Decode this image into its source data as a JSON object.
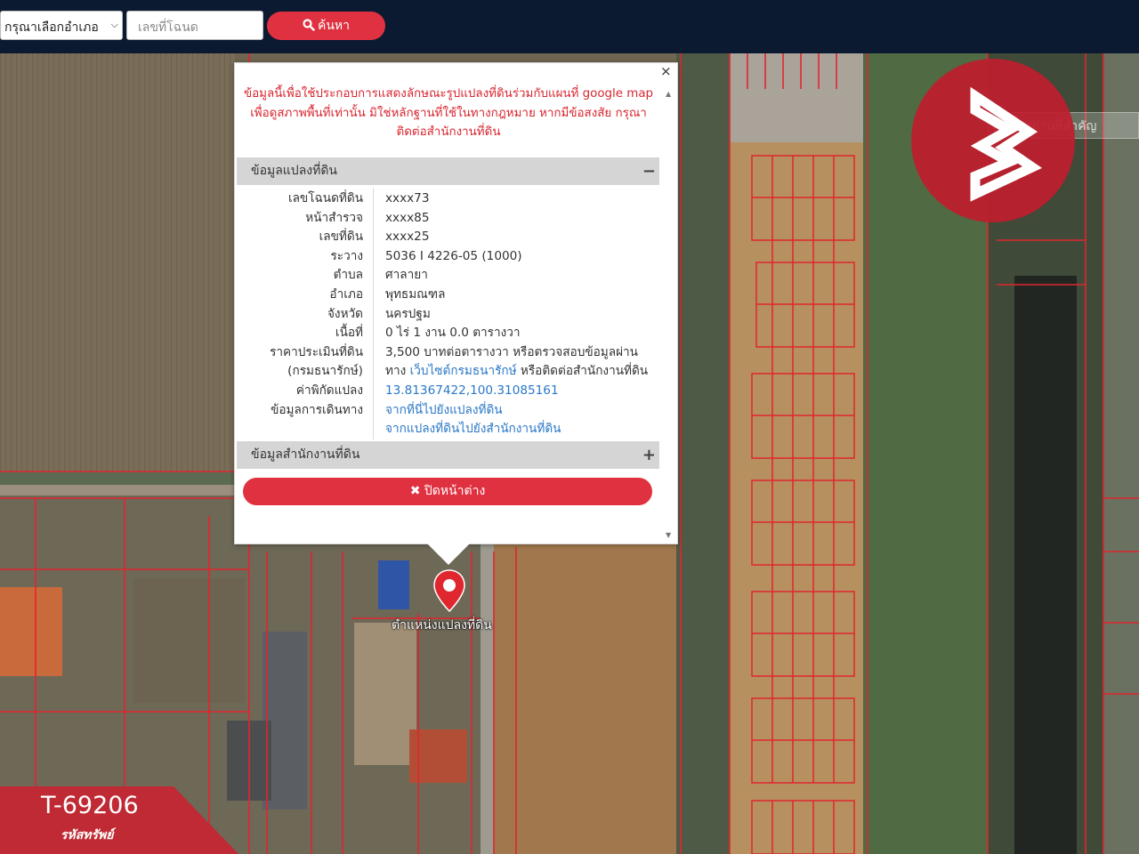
{
  "search": {
    "district_select": "กรุณาเลือกอำเภอ",
    "deed_placeholder": "เลขที่โฉนด",
    "button_label": "ค้นหา"
  },
  "map": {
    "place_search_placeholder": "ค้นหาสถานที่สำคัญ",
    "marker_label": "ตำแหน่งแปลงที่ดิน"
  },
  "popup": {
    "close_symbol": "×",
    "notice": [
      "ข้อมูลนี้เพื่อใช้ประกอบการแสดงลักษณะรูปแปลงที่ดินร่วมกับแผนที่ google map",
      "เพื่อดูสภาพพื้นที่เท่านั้น มิใช่หลักฐานที่ใช้ในทางกฎหมาย หากมีข้อสงสัย กรุณา",
      "ติดต่อสำนักงานที่ดิน"
    ],
    "section_parcel": {
      "title": "ข้อมูลแปลงที่ดิน",
      "toggle": "−"
    },
    "section_office": {
      "title": "ข้อมูลสำนักงานที่ดิน",
      "toggle": "+"
    },
    "rows": {
      "deed_no": {
        "label": "เลขโฉนดที่ดิน",
        "value": "xxxx73"
      },
      "survey_page": {
        "label": "หน้าสำรวจ",
        "value": "xxxx85"
      },
      "land_no": {
        "label": "เลขที่ดิน",
        "value": "xxxx25"
      },
      "map_sheet": {
        "label": "ระวาง",
        "value": "5036 I 4226-05 (1000)"
      },
      "subdistrict": {
        "label": "ตำบล",
        "value": "ศาลายา"
      },
      "district": {
        "label": "อำเภอ",
        "value": "พุทธมณฑล"
      },
      "province": {
        "label": "จังหวัด",
        "value": "นครปฐม"
      },
      "area": {
        "label": "เนื้อที่",
        "value": "0 ไร่ 1 งาน 0.0 ตารางวา"
      },
      "price": {
        "label": "ราคาประเมินที่ดิน",
        "value": "3,500 บาทต่อตารางวา หรือตรวจสอบข้อมูลผ่าน"
      },
      "price2": {
        "label": "(กรมธนารักษ์)",
        "prefix": "ทาง",
        "link": "เว็บไซต์กรมธนารักษ์",
        "suffix": "หรือติดต่อสำนักงานที่ดิน"
      },
      "coords": {
        "label": "ค่าพิกัดแปลง",
        "value": "13.81367422,100.31085161"
      },
      "directions": {
        "label": "ข้อมูลการเดินทาง",
        "link1": "จากที่นี่ไปยังแปลงที่ดิน",
        "link2": "จากแปลงที่ดินไปยังสำนักงานที่ดิน"
      }
    },
    "close_button": "ปิดหน้าต่าง"
  },
  "ribbon": {
    "code": "T-69206",
    "label": "รหัสทรัพย์"
  },
  "colors": {
    "accent": "#e03141",
    "topbar": "#0b1a30",
    "link": "#2a78c7",
    "notice": "#d8262f"
  }
}
